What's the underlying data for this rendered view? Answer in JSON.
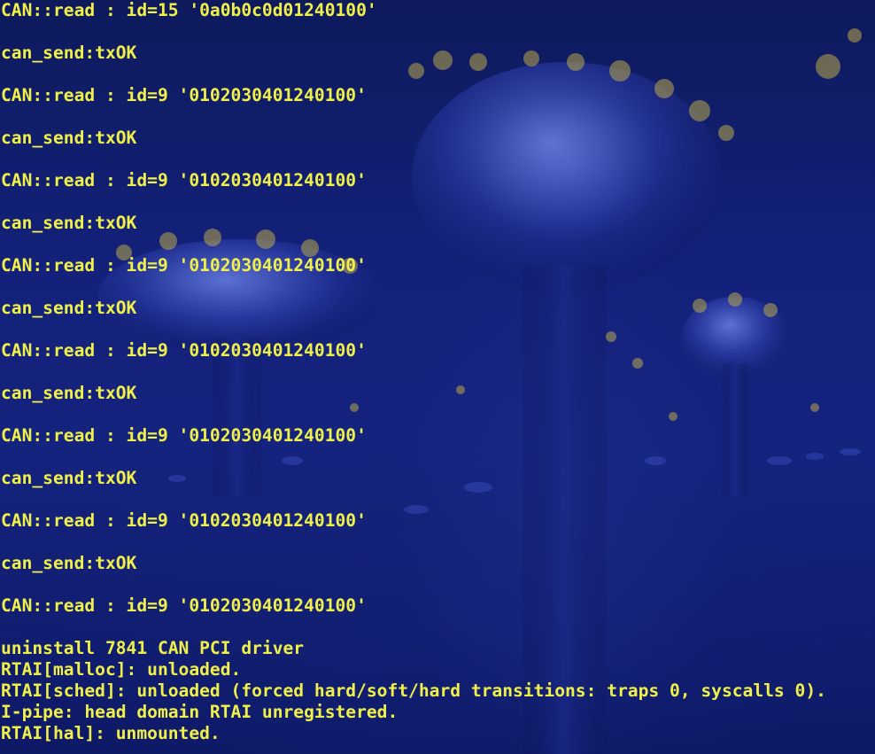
{
  "terminal": {
    "text_color": "#f0f04a",
    "background_color": "#13217a",
    "lines": [
      "CAN::read : id=15 '0a0b0c0d01240100'",
      "can_send:txOK",
      "CAN::read : id=9 '0102030401240100'",
      "can_send:txOK",
      "CAN::read : id=9 '0102030401240100'",
      "can_send:txOK",
      "CAN::read : id=9 '0102030401240100'",
      "can_send:txOK",
      "CAN::read : id=9 '0102030401240100'",
      "can_send:txOK",
      "CAN::read : id=9 '0102030401240100'",
      "can_send:txOK",
      "CAN::read : id=9 '0102030401240100'",
      "can_send:txOK",
      "CAN::read : id=9 '0102030401240100'",
      "uninstall 7841 CAN PCI driver",
      "RTAI[malloc]: unloaded.",
      "RTAI[sched]: unloaded (forced hard/soft/hard transitions: traps 0, syscalls 0).",
      "I-pipe: head domain RTAI unregistered.",
      "RTAI[hal]: unmounted."
    ]
  }
}
